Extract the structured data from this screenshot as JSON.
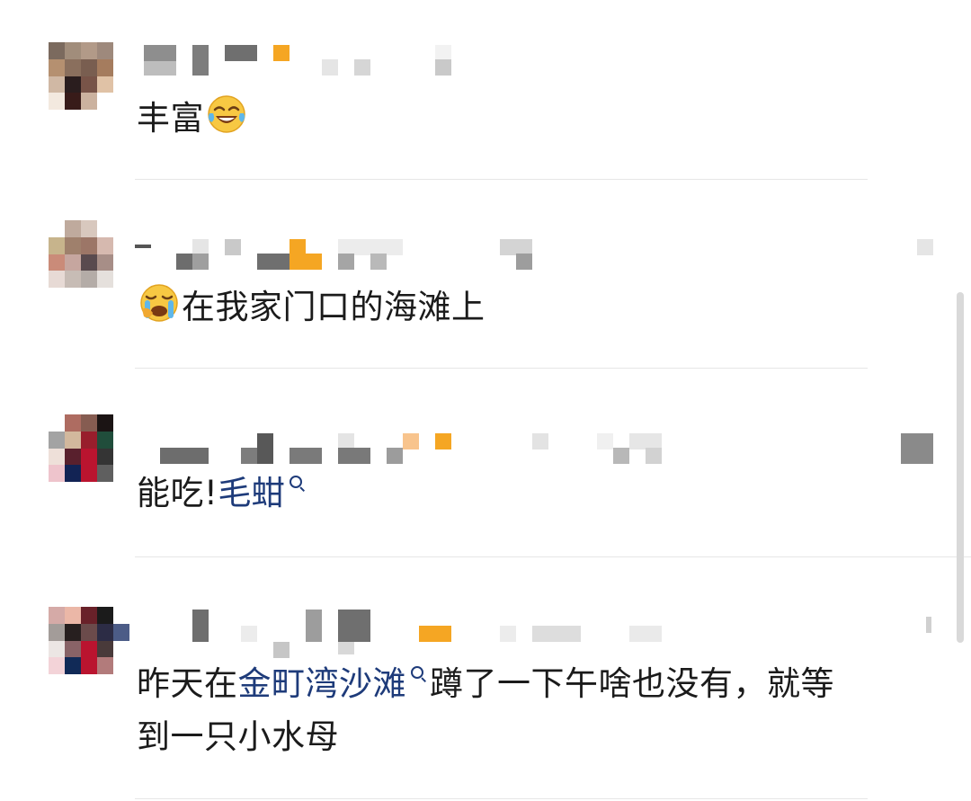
{
  "comments": [
    {
      "text_before": "丰富",
      "emoji": "face-with-tears-of-joy",
      "text_after": ""
    },
    {
      "emoji": "loudly-crying-face",
      "text": "在我家门口的海滩上"
    },
    {
      "text_before": "能吃!",
      "link": "毛蚶"
    },
    {
      "line1_before": "昨天在",
      "link": "金町湾沙滩",
      "line1_after": "蹲了一下午啥也没有，就等",
      "line2": "到一只小水母"
    }
  ],
  "colors": {
    "text": "#1b1b1b",
    "link": "#1e3b7a",
    "divider": "#e6e6e6"
  },
  "icons": {
    "search": "search-icon",
    "emoji_laugh": "face-with-tears-of-joy-icon",
    "emoji_cry": "loudly-crying-face-icon"
  }
}
